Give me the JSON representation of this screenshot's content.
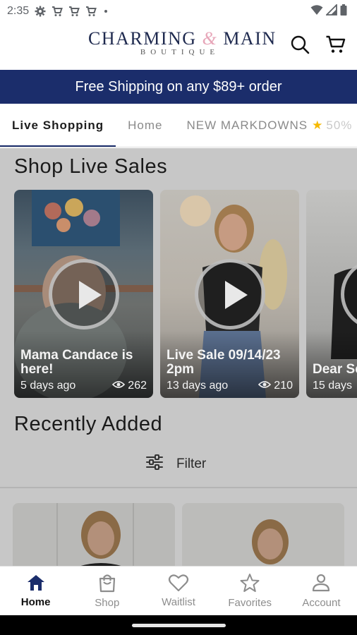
{
  "status_bar": {
    "time": "2:35",
    "left_icons": [
      "gear-icon",
      "cart-icon",
      "cart-icon",
      "cart-icon",
      "dot-icon"
    ],
    "right_icons": [
      "wifi-icon",
      "signal-icon",
      "battery-icon"
    ]
  },
  "header": {
    "logo_main_left": "CHARMING",
    "logo_amp": "&",
    "logo_main_right": "MAIN",
    "logo_sub": "BOUTIQUE",
    "search_icon": "search-icon",
    "cart_icon": "cart-icon"
  },
  "promo": {
    "text": "Free Shipping on any $89+ order"
  },
  "tabs": [
    {
      "label": "Live Shopping",
      "active": true
    },
    {
      "label": "Home",
      "active": false
    },
    {
      "label": "NEW MARKDOWNS",
      "extra": "50%",
      "active": false
    }
  ],
  "live_sales": {
    "title": "Shop Live Sales",
    "cards": [
      {
        "title": "Mama Candace is here!",
        "age": "5 days ago",
        "views": "262"
      },
      {
        "title": "Live Sale 09/14/23 2pm",
        "age": "13 days ago",
        "views": "210"
      },
      {
        "title": "Dear Sc",
        "age": "15 days",
        "views": ""
      }
    ]
  },
  "recently_added": {
    "title": "Recently Added",
    "filter_label": "Filter"
  },
  "bottom_nav": [
    {
      "label": "Home",
      "icon": "home-icon",
      "active": true
    },
    {
      "label": "Shop",
      "icon": "bag-icon",
      "active": false
    },
    {
      "label": "Waitlist",
      "icon": "heart-icon",
      "active": false
    },
    {
      "label": "Favorites",
      "icon": "star-icon",
      "active": false
    },
    {
      "label": "Account",
      "icon": "person-icon",
      "active": false
    }
  ],
  "colors": {
    "brand_navy": "#1b2d6b",
    "logo_pink": "#e7a6b9",
    "overlay_gray": "#c7c7c7",
    "star_yellow": "#f6b900"
  }
}
